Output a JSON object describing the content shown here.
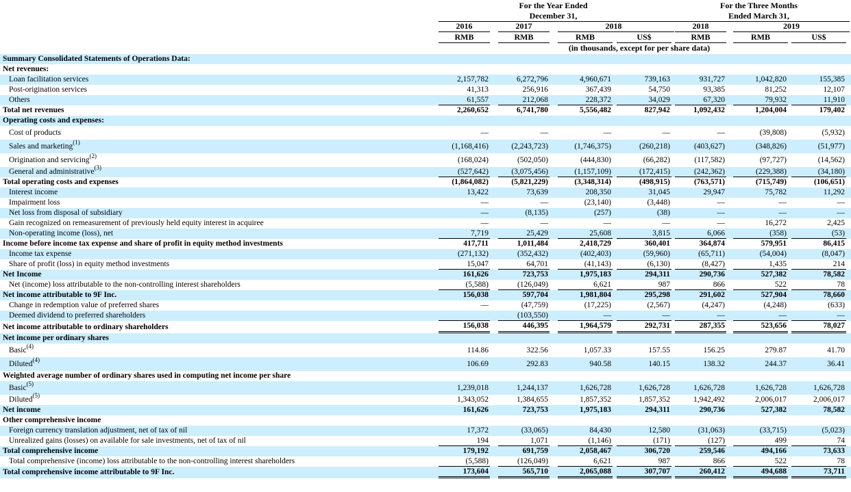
{
  "header": {
    "year_group": [
      "For the Year Ended",
      "December 31,"
    ],
    "quarter_group": [
      "For the Three Months",
      "Ended March 31,"
    ],
    "years": {
      "y2016": "2016",
      "y2017": "2017",
      "y2018": "2018",
      "q2018": "2018",
      "q2019": "2019"
    },
    "currencies": [
      "RMB",
      "RMB",
      "RMB",
      "US$",
      "RMB",
      "RMB",
      "US$"
    ],
    "units_note": "(in thousands, except for per share data)"
  },
  "rows": [
    {
      "label": "Summary Consolidated Statements of Operations Data:",
      "bold": true,
      "h": 15
    },
    {
      "label": "Net revenues:",
      "bold": true,
      "h": 15
    },
    {
      "label": "Loan facilitation services",
      "indent": true,
      "values": [
        "2,157,782",
        "6,272,796",
        "4,960,671",
        "739,163",
        "931,727",
        "1,042,820",
        "155,385"
      ],
      "h": 15
    },
    {
      "label": "Post-origination services",
      "indent": true,
      "values": [
        "41,313",
        "256,916",
        "367,439",
        "54,750",
        "93,385",
        "81,252",
        "12,107"
      ],
      "h": 15
    },
    {
      "label": "Others",
      "indent": true,
      "values": [
        "61,557",
        "212,068",
        "228,372",
        "34,029",
        "67,320",
        "79,932",
        "11,910"
      ],
      "h": 15,
      "lineBelow": true
    },
    {
      "label": "Total net revenues",
      "bold": true,
      "values": [
        "2,260,652",
        "6,741,780",
        "5,556,482",
        "827,942",
        "1,092,432",
        "1,204,004",
        "179,402"
      ],
      "h": 15
    },
    {
      "label": "Operating costs and expenses:",
      "bold": true,
      "h": 15
    },
    {
      "label": "Cost of products",
      "indent": true,
      "values": [
        "—",
        "—",
        "—",
        "—",
        "—",
        "(39,808)",
        "(5,932)"
      ],
      "h": 20
    },
    {
      "label": "Sales and marketing",
      "sup": "(1)",
      "indent": true,
      "values": [
        "(1,168,416)",
        "(2,243,723)",
        "(1,746,375)",
        "(260,218)",
        "(403,627)",
        "(348,826)",
        "(51,977)"
      ],
      "h": 20
    },
    {
      "label": "Origination and servicing",
      "sup": "(2)",
      "indent": true,
      "values": [
        "(168,024)",
        "(502,050)",
        "(444,830)",
        "(66,282)",
        "(117,582)",
        "(97,727)",
        "(14,562)"
      ],
      "h": 20
    },
    {
      "label": "General and administrative",
      "sup": "(3)",
      "indent": true,
      "values": [
        "(527,642)",
        "(3,075,456)",
        "(1,157,109)",
        "(172,415)",
        "(242,362)",
        "(229,388)",
        "(34,180)"
      ],
      "h": 15,
      "lineBelow": true
    },
    {
      "label": "Total operating costs and expenses",
      "bold": true,
      "values": [
        "(1,864,082)",
        "(5,821,229)",
        "(3,348,314)",
        "(498,915)",
        "(763,571)",
        "(715,749)",
        "(106,651)"
      ],
      "h": 15
    },
    {
      "label": "Interest income",
      "indent": true,
      "values": [
        "13,422",
        "73,639",
        "208,350",
        "31,045",
        "29,947",
        "75,782",
        "11,292"
      ],
      "h": 15
    },
    {
      "label": "Impairment loss",
      "indent": true,
      "values": [
        "—",
        "—",
        "(23,140)",
        "(3,448)",
        "—",
        "—",
        "—"
      ],
      "h": 15
    },
    {
      "label": "Net loss from disposal of subsidiary",
      "indent": true,
      "values": [
        "—",
        "(8,135)",
        "(257)",
        "(38)",
        "—",
        "—",
        "—"
      ],
      "h": 15
    },
    {
      "label": "Gain recognized on remeasurement of previously held equity interest in acquiree",
      "indent": true,
      "values": [
        "—",
        "—",
        "—",
        "—",
        "—",
        "16,272",
        "2,425"
      ],
      "h": 15
    },
    {
      "label": "Non-operating income (loss), net",
      "indent": true,
      "values": [
        "7,719",
        "25,429",
        "25,608",
        "3,815",
        "6,066",
        "(358)",
        "(53)"
      ],
      "h": 15,
      "lineBelow": true
    },
    {
      "label": "Income before income tax expense and share of profit in equity method investments",
      "bold": true,
      "values": [
        "417,711",
        "1,011,484",
        "2,418,729",
        "360,401",
        "364,874",
        "579,951",
        "86,415"
      ],
      "h": 15
    },
    {
      "label": "Income tax expense",
      "indent": true,
      "values": [
        "(271,132)",
        "(352,432)",
        "(402,403)",
        "(59,960)",
        "(65,711)",
        "(54,004)",
        "(8,047)"
      ],
      "h": 15
    },
    {
      "label": "Share of profit (loss) in equity method investments",
      "indent": true,
      "values": [
        "15,047",
        "64,701",
        "(41,143)",
        "(6,130)",
        "(8,427)",
        "1,435",
        "214"
      ],
      "h": 15,
      "lineBelow": true
    },
    {
      "label": "Net Income",
      "bold": true,
      "values": [
        "161,626",
        "723,753",
        "1,975,183",
        "294,311",
        "290,736",
        "527,382",
        "78,582"
      ],
      "h": 15
    },
    {
      "label": "Net (income) loss attributable to the non-controlling interest shareholders",
      "indent": true,
      "values": [
        "(5,588)",
        "(126,049)",
        "6,621",
        "987",
        "866",
        "522",
        "78"
      ],
      "h": 15,
      "lineBelow": true
    },
    {
      "label": "Net income attributable to 9F Inc.",
      "bold": true,
      "values": [
        "156,038",
        "597,704",
        "1,981,804",
        "295,298",
        "291,602",
        "527,904",
        "78,660"
      ],
      "h": 15
    },
    {
      "label": "Change in redemption value of preferred shares",
      "indent": true,
      "values": [
        "—",
        "(47,759)",
        "(17,225)",
        "(2,567)",
        "(4,247)",
        "(4,248)",
        "(633)"
      ],
      "h": 15
    },
    {
      "label": "Deemed dividend to preferred shareholders",
      "indent": true,
      "values": [
        "",
        "(103,550)",
        "—",
        "—",
        "—",
        "—",
        "—"
      ],
      "h": 15,
      "lineBelow": true
    },
    {
      "label": "Net income attributable to ordinary shareholders",
      "bold": true,
      "values": [
        "156,038",
        "446,395",
        "1,964,579",
        "292,731",
        "287,355",
        "523,656",
        "78,027"
      ],
      "h": 18,
      "doubleBelow": true
    },
    {
      "label": "Net income per ordinary shares",
      "bold": true,
      "h": 15
    },
    {
      "label": "Basic",
      "sup": "(4)",
      "indent": true,
      "values": [
        "114.86",
        "322.56",
        "1,057.33",
        "157.55",
        "156.25",
        "279.87",
        "41.70"
      ],
      "h": 20
    },
    {
      "label": "Diluted",
      "sup": "(4)",
      "indent": true,
      "values": [
        "106.69",
        "292.83",
        "940.58",
        "140.15",
        "138.32",
        "244.37",
        "36.41"
      ],
      "h": 20
    },
    {
      "label": "Weighted average number of ordinary shares used in computing net income per share",
      "bold": true,
      "h": 15
    },
    {
      "label": "Basic",
      "sup": "(5)",
      "indent": true,
      "values": [
        "1,239,018",
        "1,244,137",
        "1,626,728",
        "1,626,728",
        "1,626,728",
        "1,626,728",
        "1,626,728"
      ],
      "h": 20
    },
    {
      "label": "Diluted",
      "sup": "(5)",
      "indent": true,
      "values": [
        "1,343,052",
        "1,384,655",
        "1,857,352",
        "1,857,352",
        "1,942,492",
        "2,006,017",
        "2,006,017"
      ],
      "h": 15
    },
    {
      "label": "Net income",
      "bold": true,
      "values": [
        "161,626",
        "723,753",
        "1,975,183",
        "294,311",
        "290,736",
        "527,382",
        "78,582"
      ],
      "h": 15
    },
    {
      "label": "Other comprehensive income",
      "bold": true,
      "h": 15
    },
    {
      "label": "Foreign currency translation adjustment, net of tax of nil",
      "indent": true,
      "values": [
        "17,372",
        "(33,065)",
        "84,430",
        "12,580",
        "(31,063)",
        "(33,715)",
        "(5,023)"
      ],
      "h": 15
    },
    {
      "label": "Unrealized gains (losses) on available for sale investments, net of tax of nil",
      "indent": true,
      "values": [
        "194",
        "1,071",
        "(1,146)",
        "(171)",
        "(127)",
        "499",
        "74"
      ],
      "h": 15,
      "lineBelow": true
    },
    {
      "label": "Total comprehensive income",
      "bold": true,
      "values": [
        "179,192",
        "691,759",
        "2,058,467",
        "306,720",
        "259,546",
        "494,166",
        "73,633"
      ],
      "h": 15
    },
    {
      "label": "Total comprehensive (income) loss attributable to the non-controlling interest shareholders",
      "indent": true,
      "values": [
        "(5,588)",
        "(126,049)",
        "6,621",
        "987",
        "866",
        "522",
        "78"
      ],
      "h": 15,
      "lineBelow": true
    },
    {
      "label": "Total comprehensive income attributable to 9F Inc.",
      "bold": true,
      "values": [
        "173,604",
        "565,710",
        "2,065,088",
        "307,707",
        "260,412",
        "494,688",
        "73,711"
      ],
      "h": 17,
      "doubleBelow": true
    }
  ]
}
